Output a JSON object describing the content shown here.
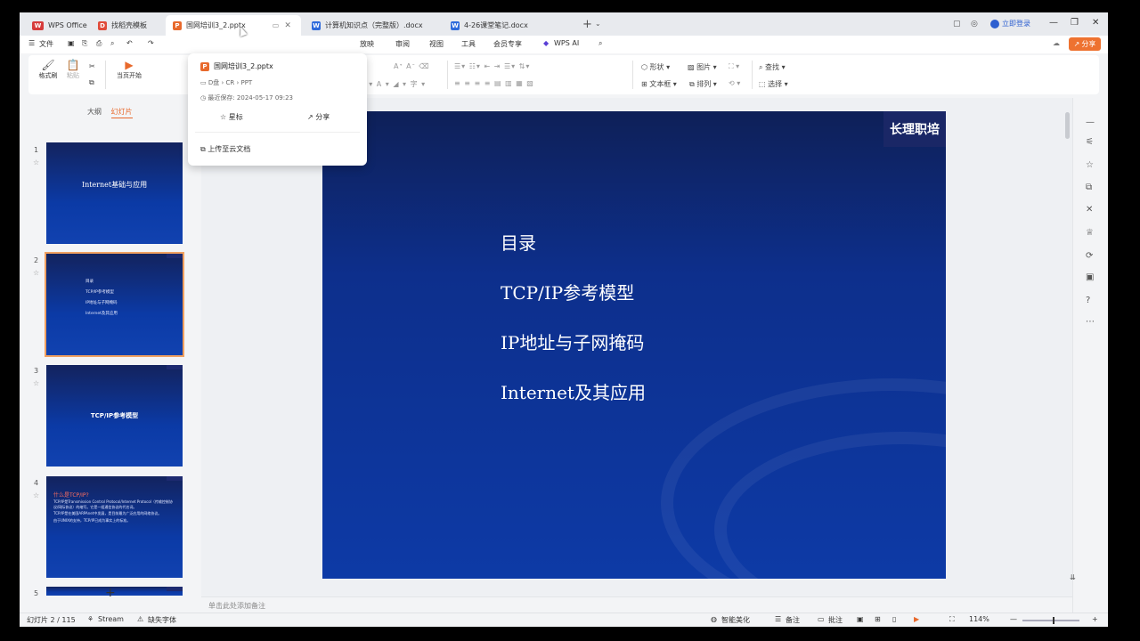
{
  "tabs": [
    {
      "label": "WPS Office",
      "badge": "W"
    },
    {
      "label": "找稻壳模板",
      "badge": "D"
    },
    {
      "label": "国网培训3_2.pptx",
      "badge": "P"
    },
    {
      "label": "计算机知识点（完整版）.docx",
      "badge": "W"
    },
    {
      "label": "4-26课堂笔记.docx",
      "badge": "W"
    }
  ],
  "login": "立即登录",
  "share": "分享",
  "menu": {
    "file": "文件",
    "items": [
      "放映",
      "审阅",
      "视图",
      "工具",
      "会员专享",
      "WPS AI"
    ]
  },
  "ribbon": {
    "format_painter": "格式刷",
    "paste": "粘贴",
    "start_from_current": "当页开始",
    "shape": "形状",
    "image": "图片",
    "find": "查找",
    "textbox": "文本框",
    "arrange": "排列",
    "select": "选择"
  },
  "left_tabs": {
    "outline": "大纲",
    "slides": "幻灯片"
  },
  "thumbnails": {
    "t1_title": "Internet基础与应用",
    "t2_lines": [
      "目录",
      "TCP/IP参考模型",
      "IP地址与子网掩码",
      "Internet及其应用"
    ],
    "t3_title": "TCP/IP参考模型",
    "t4_title": "什么是TCP/IP?",
    "t4_bullets": [
      "TCP/IP是Transmission Control Protocol/Internet Protocol（传输控制协议/网际协议）的缩写。它是一组通信协议的代名词。",
      "TCP/IP是在美国ARPAnet中发展，是目前最为广泛应用的网络协议。",
      "由于UNIX的支持，TCP/IP已成为事实上的标准。"
    ],
    "numbers": [
      "1",
      "2",
      "3",
      "4",
      "5"
    ]
  },
  "slide": {
    "logo": "长理职培",
    "items": [
      "目录",
      "TCP/IP参考模型",
      "IP地址与子网掩码",
      "Internet及其应用"
    ]
  },
  "notes_placeholder": "单击此处添加备注",
  "popup": {
    "filename": "国网培训3_2.pptx",
    "path": "D盘 › CR › PPT",
    "saved": "最近保存: 2024-05-17 09:23",
    "star": "星标",
    "share": "分享",
    "upload": "上传至云文档"
  },
  "status": {
    "slide_count": "幻灯片 2 / 115",
    "stream": "Stream",
    "missing_font": "缺失字体",
    "beautify": "智能美化",
    "notes": "备注",
    "comments": "批注",
    "zoom": "114%"
  }
}
